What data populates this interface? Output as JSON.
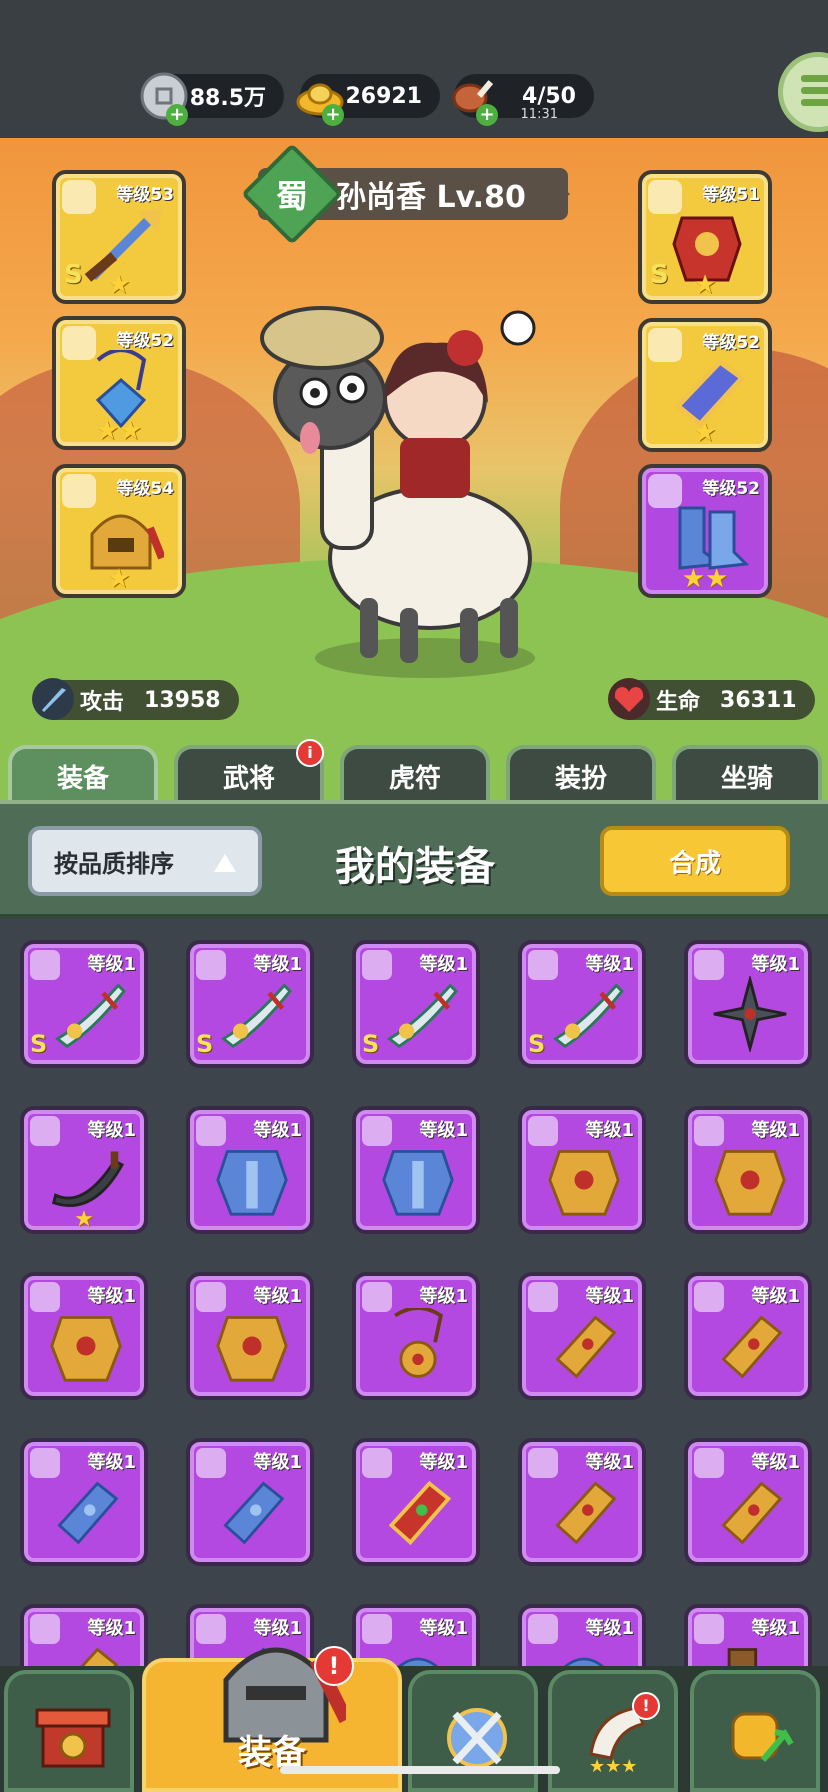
{
  "resources": {
    "silver": {
      "value": "88.5万"
    },
    "gold": {
      "value": "26921"
    },
    "stamina": {
      "value": "4/50",
      "timer": "11:31"
    }
  },
  "hero": {
    "kingdom": "蜀",
    "name": "孙尚香 Lv.80",
    "attack_label": "攻击",
    "attack_value": "13958",
    "hp_label": "生命",
    "hp_value": "36311"
  },
  "equipped": {
    "weapon": {
      "level": "等级53",
      "grade": "S",
      "stars": "★"
    },
    "amulet": {
      "level": "等级52",
      "stars": "★★"
    },
    "helmet": {
      "level": "等级54",
      "stars": "★"
    },
    "armor": {
      "level": "等级51",
      "grade": "S",
      "stars": "★"
    },
    "bracer": {
      "level": "等级52",
      "stars": "★"
    },
    "boots": {
      "level": "等级52",
      "stars": "★★"
    }
  },
  "tabs": [
    {
      "label": "装备"
    },
    {
      "label": "武将",
      "badge": "i"
    },
    {
      "label": "虎符"
    },
    {
      "label": "装扮"
    },
    {
      "label": "坐骑"
    }
  ],
  "panel": {
    "sort_label": "按品质排序",
    "title": "我的装备",
    "merge_label": "合成"
  },
  "inventory": [
    {
      "level": "等级1",
      "grade": "S",
      "stars": "",
      "kind": "sword"
    },
    {
      "level": "等级1",
      "grade": "S",
      "stars": "",
      "kind": "sword"
    },
    {
      "level": "等级1",
      "grade": "S",
      "stars": "",
      "kind": "sword"
    },
    {
      "level": "等级1",
      "grade": "S",
      "stars": "",
      "kind": "sword"
    },
    {
      "level": "等级1",
      "grade": "",
      "stars": "",
      "kind": "shuriken"
    },
    {
      "level": "等级1",
      "grade": "",
      "stars": "★",
      "kind": "blade"
    },
    {
      "level": "等级1",
      "grade": "",
      "stars": "",
      "kind": "armor-blue"
    },
    {
      "level": "等级1",
      "grade": "",
      "stars": "",
      "kind": "armor-blue"
    },
    {
      "level": "等级1",
      "grade": "",
      "stars": "",
      "kind": "armor-gold"
    },
    {
      "level": "等级1",
      "grade": "",
      "stars": "",
      "kind": "armor-gold"
    },
    {
      "level": "等级1",
      "grade": "",
      "stars": "",
      "kind": "armor-gold"
    },
    {
      "level": "等级1",
      "grade": "",
      "stars": "",
      "kind": "armor-gold"
    },
    {
      "level": "等级1",
      "grade": "",
      "stars": "",
      "kind": "amulet"
    },
    {
      "level": "等级1",
      "grade": "",
      "stars": "",
      "kind": "bracer-gold"
    },
    {
      "level": "等级1",
      "grade": "",
      "stars": "",
      "kind": "bracer-gold"
    },
    {
      "level": "等级1",
      "grade": "",
      "stars": "",
      "kind": "bracer-blue"
    },
    {
      "level": "等级1",
      "grade": "",
      "stars": "",
      "kind": "bracer-blue"
    },
    {
      "level": "等级1",
      "grade": "",
      "stars": "",
      "kind": "bracer-red"
    },
    {
      "level": "等级1",
      "grade": "",
      "stars": "",
      "kind": "bracer-gold"
    },
    {
      "level": "等级1",
      "grade": "",
      "stars": "",
      "kind": "bracer-gold"
    },
    {
      "level": "等级1",
      "grade": "",
      "stars": "",
      "kind": "bracer-gold"
    },
    {
      "level": "等级1",
      "grade": "",
      "stars": "",
      "kind": "bracer-blue"
    },
    {
      "level": "等级1",
      "grade": "",
      "stars": "",
      "kind": "helmet"
    },
    {
      "level": "等级1",
      "grade": "",
      "stars": "",
      "kind": "helmet"
    },
    {
      "level": "等级1",
      "grade": "",
      "stars": "",
      "kind": "boots"
    }
  ],
  "bottom_nav": {
    "active_label": "装备",
    "badge": "!"
  }
}
